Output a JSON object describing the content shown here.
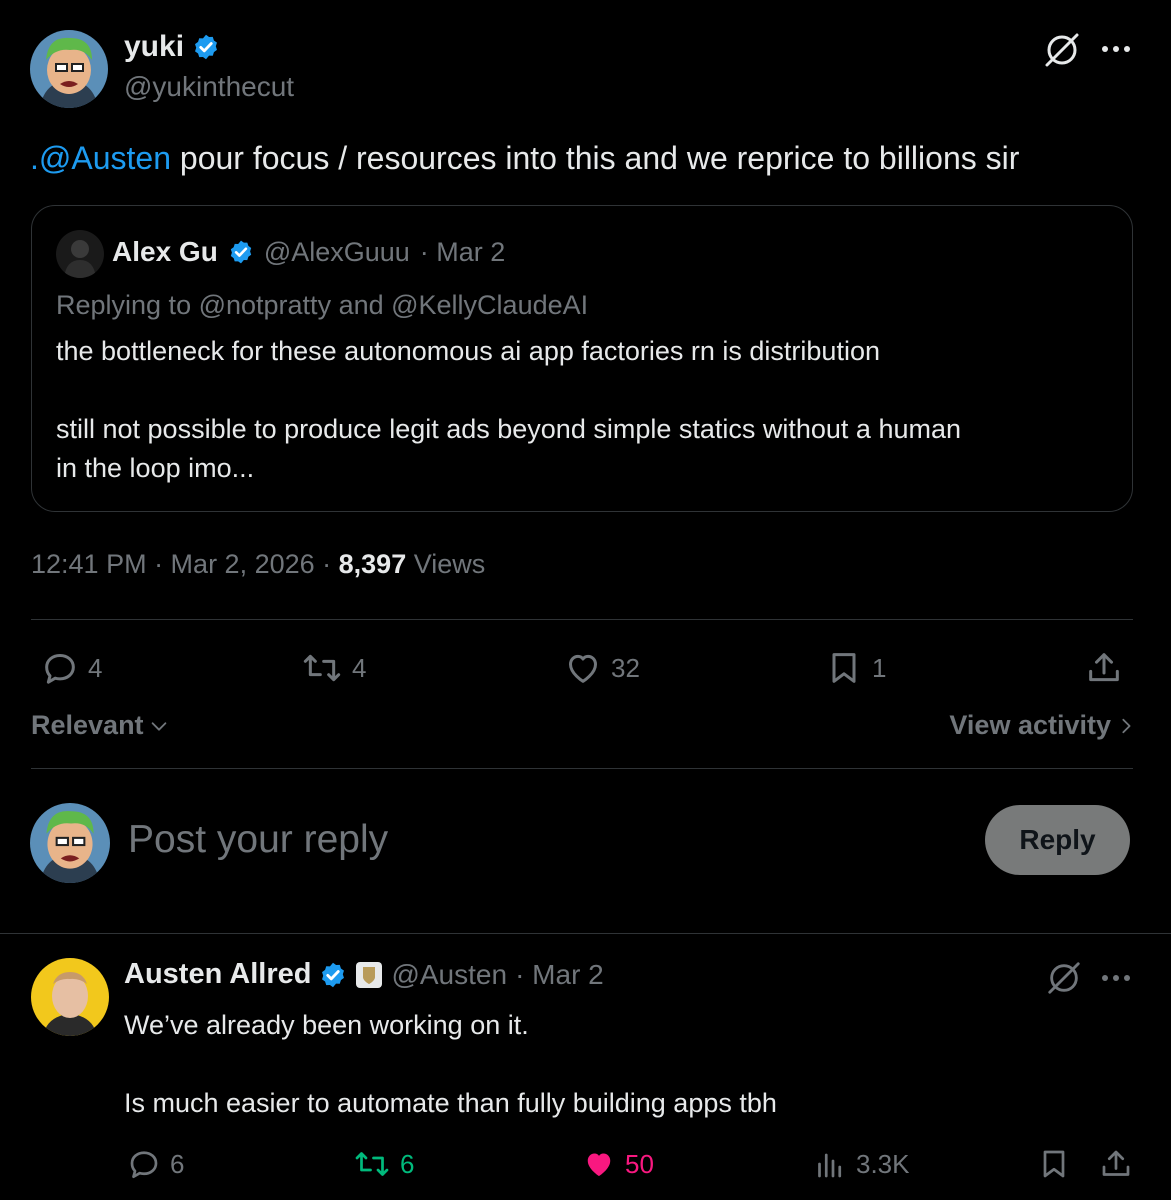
{
  "main_tweet": {
    "author": {
      "name": "yuki",
      "handle": "@yukinthecut"
    },
    "mention": ".@Austen",
    "text": " pour focus / resources into this and we reprice to billions sir",
    "quote": {
      "author": "Alex Gu",
      "handle": "@AlexGuuu",
      "date": "· Mar 2",
      "replying_prefix": "Replying to ",
      "replying_user1": "@notpratty",
      "replying_and": " and ",
      "replying_user2": "@KellyClaudeAI",
      "line1": "the bottleneck for these autonomous ai app factories rn is distribution",
      "line2": "still not possible to produce legit ads beyond simple statics without a human",
      "line3": "in the loop imo..."
    },
    "time": "12:41 PM · Mar 2, 2026 · ",
    "views_count": "8,397",
    "views_label": " Views",
    "stats": {
      "replies": "4",
      "reposts": "4",
      "likes": "32",
      "bookmarks": "1"
    }
  },
  "sort": {
    "label": "Relevant",
    "view_activity": "View activity"
  },
  "composer": {
    "placeholder": "Post your reply",
    "button": "Reply"
  },
  "reply": {
    "author": "Austen Allred",
    "handle": "@Austen",
    "date": "· Mar 2",
    "line1": "We’ve already been working on it.",
    "line2": "Is much easier to automate than fully building apps tbh",
    "stats": {
      "replies": "6",
      "reposts": "6",
      "likes": "50",
      "views": "3.3K"
    }
  },
  "colors": {
    "background": "#000000",
    "text": "#e7e9ea",
    "muted": "#71767b",
    "link": "#1d9bf0",
    "verified": "#1d9bf0",
    "repost_active": "#00ba7c",
    "like_active": "#f91880"
  }
}
